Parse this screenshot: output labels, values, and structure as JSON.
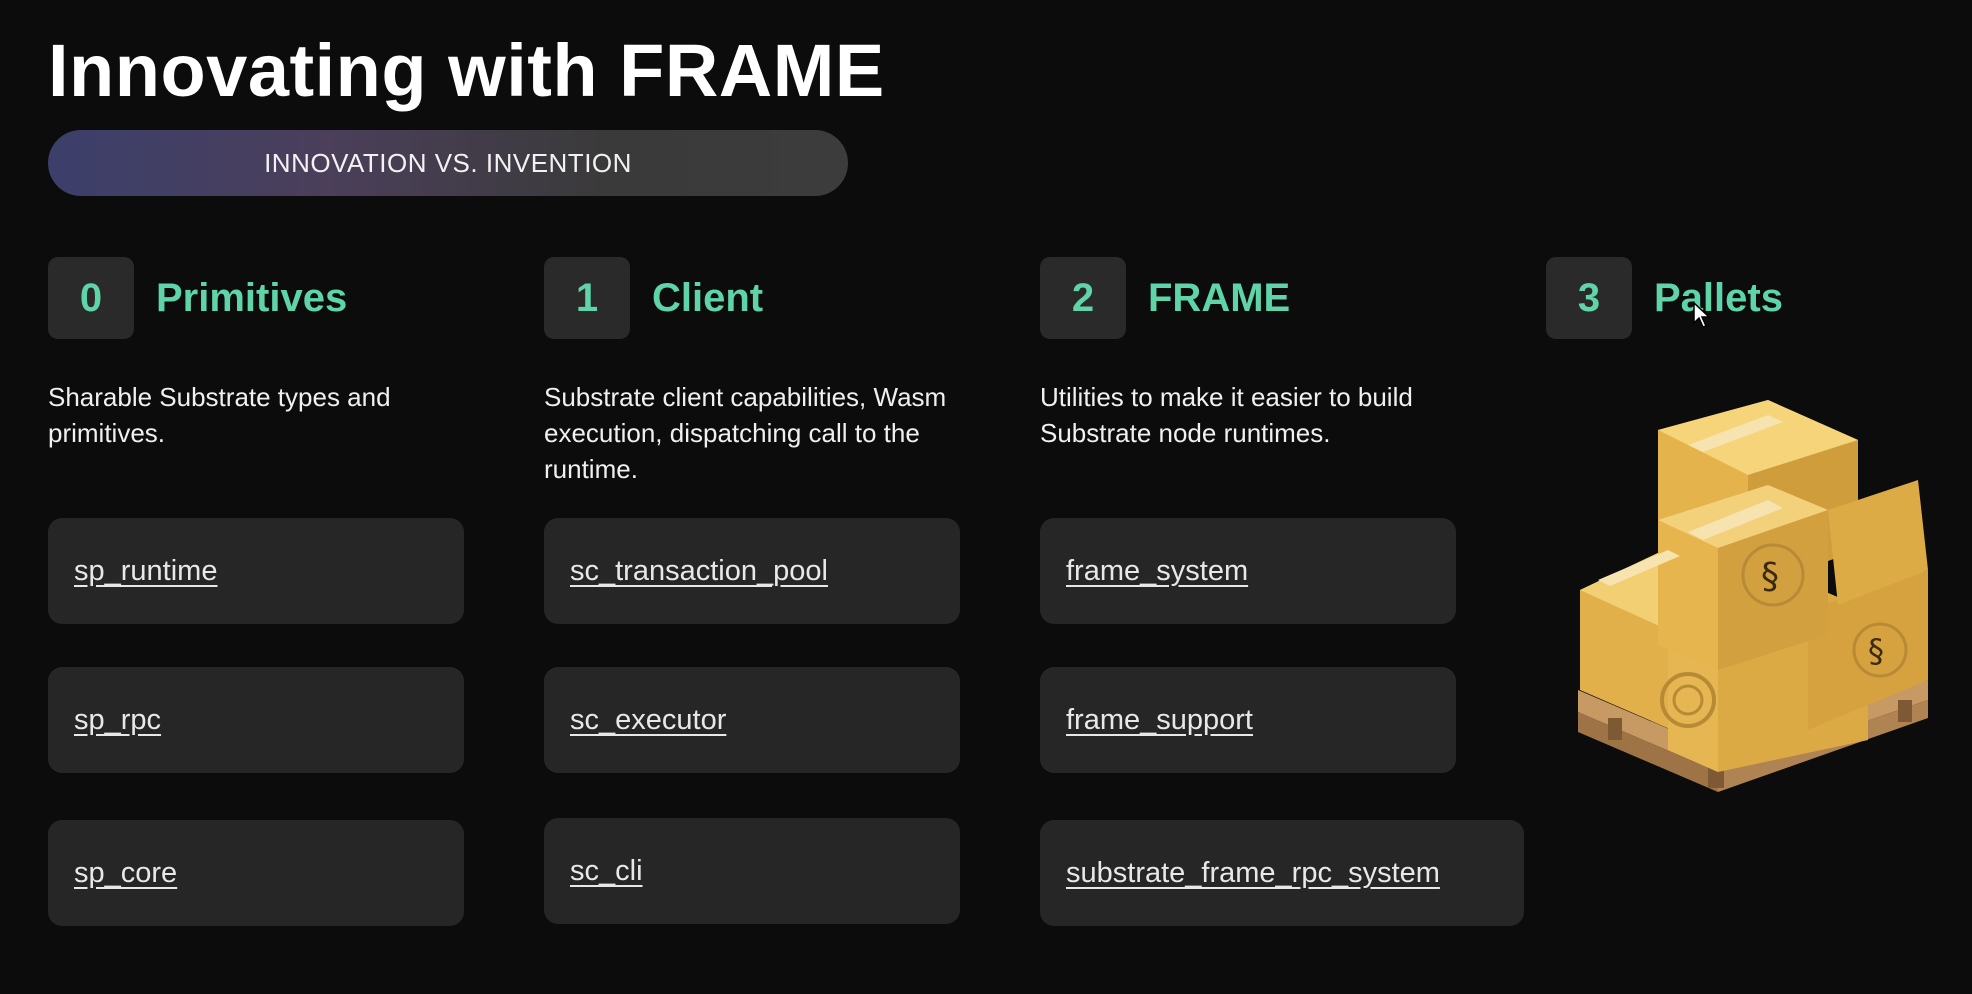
{
  "slide": {
    "title": "Innovating with FRAME",
    "subtitle": "INNOVATION VS. INVENTION"
  },
  "columns": [
    {
      "number": "0",
      "title": "Primitives",
      "description": "Sharable Substrate types and primitives.",
      "items": [
        "sp_runtime",
        "sp_rpc",
        "sp_core"
      ]
    },
    {
      "number": "1",
      "title": "Client",
      "description": "Substrate client capabilities, Wasm execution, dispatching call to the runtime.",
      "items": [
        "sc_transaction_pool",
        "sc_executor",
        "sc_cli"
      ]
    },
    {
      "number": "2",
      "title": "FRAME",
      "description": "Utilities to make it easier to build Substrate node runtimes.",
      "items": [
        "frame_system",
        "frame_support",
        "substrate_frame_rpc_system"
      ]
    },
    {
      "number": "3",
      "title": "Pallets"
    }
  ],
  "colors": {
    "accent": "#5fd4a8",
    "background": "#0c0c0c",
    "card": "#262626",
    "box": "#e7b94f"
  },
  "icons": [
    "pallet-boxes-icon",
    "cursor-icon"
  ]
}
